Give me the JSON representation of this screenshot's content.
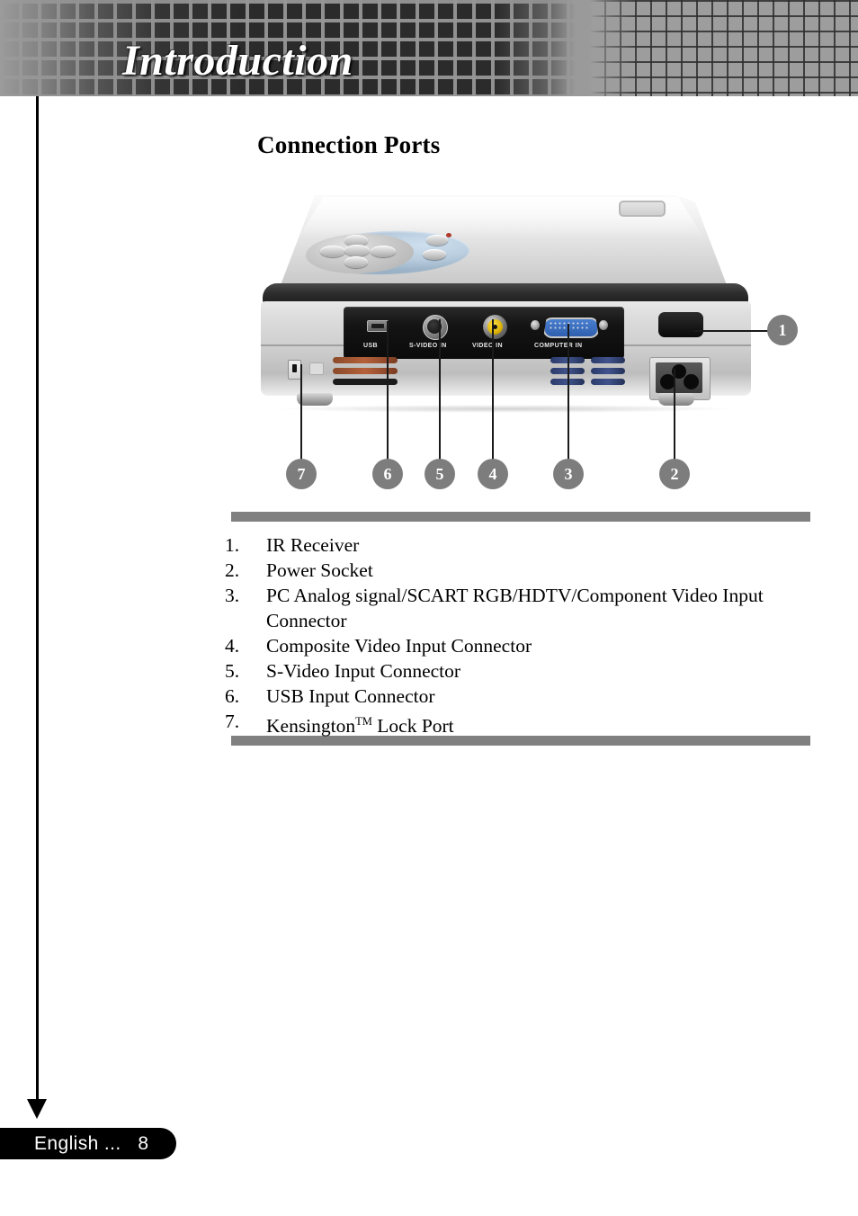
{
  "header": {
    "chapter_title": "Introduction"
  },
  "page_title": "Connection Ports",
  "figure": {
    "alt_name": "projector-rear-connection-ports",
    "port_labels": {
      "usb": "USB",
      "svideo": "S-VIDEO IN",
      "video": "VIDEO IN",
      "computer": "COMPUTER IN"
    },
    "callouts": [
      {
        "number": "1"
      },
      {
        "number": "2"
      },
      {
        "number": "3"
      },
      {
        "number": "4"
      },
      {
        "number": "5"
      },
      {
        "number": "6"
      },
      {
        "number": "7"
      }
    ]
  },
  "port_list": [
    {
      "num": "1.",
      "text": "IR Receiver"
    },
    {
      "num": "2.",
      "text": "Power  Socket"
    },
    {
      "num": "3.",
      "text": "PC Analog signal/SCART RGB/HDTV/Component Video Input Connector"
    },
    {
      "num": "4.",
      "text": "Composite Video Input Connector"
    },
    {
      "num": "5.",
      "text": "S-Video Input Connector"
    },
    {
      "num": "6.",
      "text": "USB Input Connector"
    },
    {
      "num": "7.",
      "text": "Kensington",
      "sup": "TM",
      "text_after": " Lock Port"
    }
  ],
  "footer": {
    "text": "English ...   8"
  },
  "colors": {
    "gray_rule": "#808080",
    "callout_bubble": "#7d7d7d",
    "footer_background": "#000000",
    "header_mesh": "#9d9d9d"
  }
}
